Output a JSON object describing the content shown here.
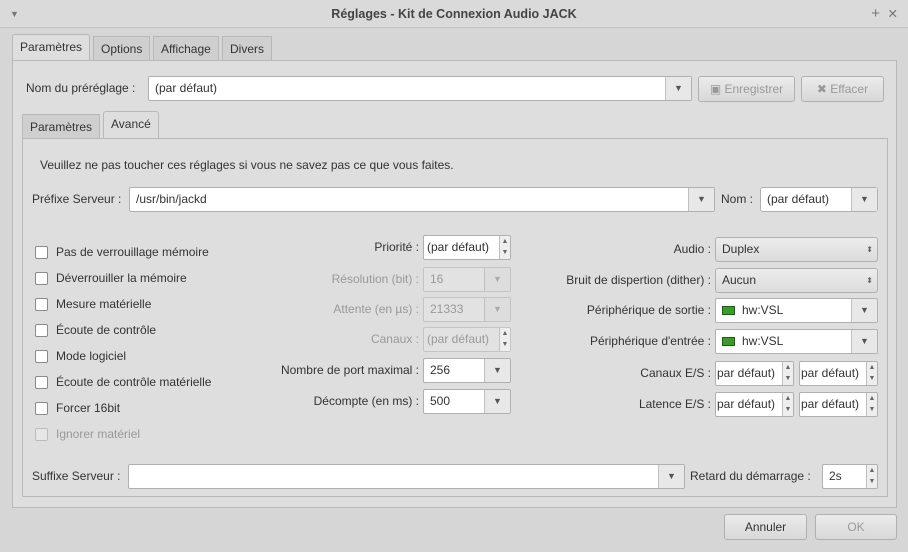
{
  "window": {
    "title": "Réglages - Kit de Connexion Audio JACK"
  },
  "outer_tabs": [
    "Paramètres",
    "Options",
    "Affichage",
    "Divers"
  ],
  "preset": {
    "label": "Nom du préréglage :",
    "value": "(par défaut)",
    "save": "Enregistrer",
    "delete": "Effacer"
  },
  "inner_tabs": [
    "Paramètres",
    "Avancé"
  ],
  "warning": "Veuillez ne pas toucher ces réglages si vous ne savez pas ce que vous faites.",
  "server_prefix": {
    "label": "Préfixe Serveur :",
    "value": "/usr/bin/jackd"
  },
  "name": {
    "label": "Nom :",
    "value": "(par défaut)"
  },
  "checkboxes": [
    {
      "label": "Pas de verrouillage mémoire",
      "checked": false,
      "enabled": true
    },
    {
      "label": "Déverrouiller la mémoire",
      "checked": false,
      "enabled": true
    },
    {
      "label": "Mesure matérielle",
      "checked": false,
      "enabled": true
    },
    {
      "label": "Écoute de contrôle",
      "checked": false,
      "enabled": true
    },
    {
      "label": "Mode logiciel",
      "checked": false,
      "enabled": true
    },
    {
      "label": "Écoute de contrôle matérielle",
      "checked": false,
      "enabled": true
    },
    {
      "label": "Forcer 16bit",
      "checked": false,
      "enabled": true
    },
    {
      "label": "Ignorer matériel",
      "checked": false,
      "enabled": false
    }
  ],
  "mid": {
    "priority": {
      "label": "Priorité :",
      "value": "(par défaut)"
    },
    "resolution": {
      "label": "Résolution (bit) :",
      "value": "16"
    },
    "wait": {
      "label": "Attente (en µs) :",
      "value": "21333"
    },
    "channels": {
      "label": "Canaux :",
      "value": "(par défaut)"
    },
    "max_ports": {
      "label": "Nombre de port maximal :",
      "value": "256"
    },
    "timeout": {
      "label": "Décompte (en ms) :",
      "value": "500"
    }
  },
  "right": {
    "audio": {
      "label": "Audio :",
      "value": "Duplex"
    },
    "dither": {
      "label": "Bruit de dispertion (dither) :",
      "value": "Aucun"
    },
    "out_dev": {
      "label": "Périphérique de sortie :",
      "value": "hw:VSL"
    },
    "in_dev": {
      "label": "Périphérique d'entrée :",
      "value": "hw:VSL"
    },
    "io_channels": {
      "label": "Canaux E/S :",
      "in": "par défaut)",
      "out": "par défaut)"
    },
    "io_latency": {
      "label": "Latence E/S :",
      "in": "par défaut)",
      "out": "par défaut)"
    }
  },
  "server_suffix": {
    "label": "Suffixe Serveur :",
    "value": ""
  },
  "start_delay": {
    "label": "Retard du démarrage :",
    "value": "2s"
  },
  "buttons": {
    "cancel": "Annuler",
    "ok": "OK"
  }
}
